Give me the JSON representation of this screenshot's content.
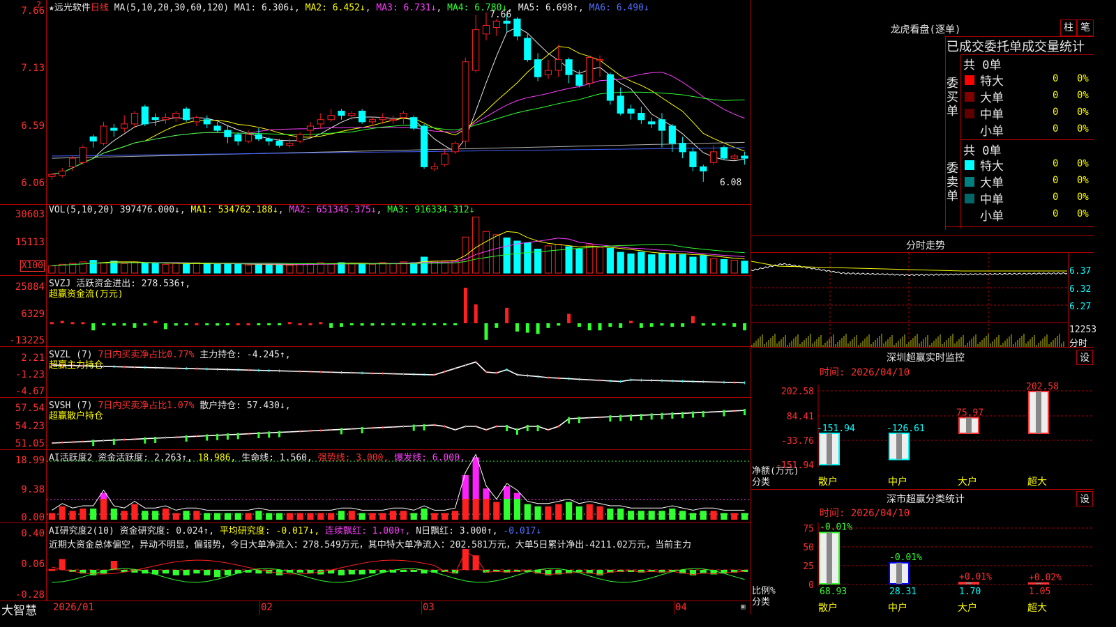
{
  "colors": {
    "up": "#ff2020",
    "down": "#00ffff",
    "grid": "#b00000"
  },
  "main_chart": {
    "header": {
      "star": "★",
      "name": "远光软件",
      "period": "日线",
      "ma_title": "MA(5,10,20,30,60,120)",
      "ma1": "MA1: 6.306↓",
      "ma2": "MA2: 6.452↓",
      "ma3": "MA3: 6.731↓",
      "ma4": "MA4: 6.780↓",
      "ma5": "MA5: 6.698↑",
      "ma6": "MA6: 6.490↓"
    },
    "y_ticks": [
      "7.66",
      "7.13",
      "6.59",
      "6.06"
    ],
    "high_label": "7.66",
    "low_label": "6.08"
  },
  "vol_panel": {
    "title": "VOL(5,10,20)",
    "vol": "397476.000↓",
    "ma1": "MA1: 534762.188↓",
    "ma2": "MA2: 651345.375↓",
    "ma3": "MA3: 916334.312↓",
    "y_ticks": [
      "30603",
      "15113"
    ],
    "unit": "X100"
  },
  "svzj_panel": {
    "title": "SVZJ  活跃资金进出: 278.536↑,",
    "subtitle": "超赢资金流(万元)",
    "y_ticks": [
      "25884",
      "6329",
      "-13225"
    ]
  },
  "svzl_panel": {
    "title": "SVZL (7) ",
    "title_red": "7日内买卖净占比0.77%",
    "title_w": " 主力持仓: -4.245↑,",
    "subtitle": "超赢主力持仓",
    "y_ticks": [
      "2.21",
      "-1.23",
      "-4.67"
    ]
  },
  "svsh_panel": {
    "title": "SVSH (7) ",
    "title_red": "7日内买卖净占比1.07%",
    "title_w": " 散户持仓: 57.430↓,",
    "subtitle": "超赢散户持仓",
    "y_ticks": [
      "57.54",
      "54.23",
      "51.05"
    ]
  },
  "ai_act_panel": {
    "t1": "AI活跃度2 资金活跃度: 2.263↑,",
    "t2": "18.986,",
    "t3": "生命线: 1.560,",
    "t4": "强势线: 3.000,",
    "t5": "爆发线: 6.000,",
    "y_ticks": [
      "18.99",
      "9.38",
      "0.00"
    ]
  },
  "ai_res_panel": {
    "t1": "AI研究度2(10) 资金研究度: 0.024↑,",
    "t2": "平均研究度: -0.017↓,",
    "t3": "连续飘红: 1.000↑,",
    "t4": "N日飘红: 3.000↑,",
    "t5": "-0.017↓",
    "summary": "近期大资金总体偏空，异动不明显，偏弱势，今日大单净流入：278.549万元，其中特大单净流入：202.581万元，大单5日累计净出-4211.02万元，当前主力",
    "y_ticks": [
      "0.40",
      "0.06",
      "-0.28"
    ]
  },
  "x_axis": {
    "labels": [
      "2026/01",
      "02",
      "03",
      "04"
    ],
    "brand": "大智慧"
  },
  "right": {
    "lhb_title": "龙虎看盘(逐单)",
    "btn_zhu": "柱",
    "btn_bi": "笔",
    "stats_title": "已成交委托单成交量统计",
    "buy": {
      "label": "委买单",
      "total": "共 0单",
      "rows": [
        {
          "name": "特大",
          "val": "0",
          "pct": "0%",
          "color": "#ff0000"
        },
        {
          "name": "大单",
          "val": "0",
          "pct": "0%",
          "color": "#800000"
        },
        {
          "name": "中单",
          "val": "0",
          "pct": "0%",
          "color": "#600000"
        },
        {
          "name": "小单",
          "val": "0",
          "pct": "0%",
          "color": "#000000"
        }
      ]
    },
    "sell": {
      "label": "委卖单",
      "total": "共 0单",
      "rows": [
        {
          "name": "特大",
          "val": "0",
          "pct": "0%",
          "color": "#00ffff"
        },
        {
          "name": "大单",
          "val": "0",
          "pct": "0%",
          "color": "#008080"
        },
        {
          "name": "中单",
          "val": "0",
          "pct": "0%",
          "color": "#006868"
        },
        {
          "name": "小单",
          "val": "0",
          "pct": "0%",
          "color": "#000000"
        }
      ]
    },
    "fenshi": {
      "title": "分时走势",
      "prices": [
        "6.37",
        "6.32",
        "6.27"
      ],
      "vol": "12253",
      "unit": "分时"
    },
    "monitor": {
      "title": "深圳超赢实时监控",
      "btn": "设",
      "time": "时间: 2026/04/10",
      "y_ticks": [
        "202.58",
        "84.41",
        "-33.76",
        "-151.94"
      ],
      "ylabel": "净额(万元)",
      "xlabel": "分类",
      "cats": [
        "散户",
        "中户",
        "大户",
        "超大"
      ],
      "values": [
        -151.94,
        -126.61,
        75.97,
        202.58
      ],
      "labels": [
        "-151.94",
        "-126.61",
        "75.97",
        "202.58"
      ]
    },
    "classify": {
      "title": "深市超赢分类统计",
      "btn": "设",
      "time": "时间: 2026/04/10",
      "y_ticks": [
        "75",
        "50",
        "25",
        "0"
      ],
      "ylabel": "比例%",
      "xlabel": "分类",
      "cats": [
        "散户",
        "中户",
        "大户",
        "超大"
      ],
      "values": [
        68.93,
        28.31,
        1.7,
        1.05
      ],
      "bottom_labels": [
        "68.93",
        "28.31",
        "1.70",
        "1.05"
      ],
      "top_labels": [
        "-0.01%",
        "-0.01%",
        "+0.01%",
        "+0.02%"
      ]
    }
  },
  "chart_data": {
    "type": "candlestick",
    "title": "远光软件 日线",
    "x": [
      "2026/01",
      "02",
      "03",
      "04"
    ],
    "ylim": [
      6.06,
      7.66
    ],
    "candles": [
      [
        6.13,
        6.15,
        6.1,
        6.16
      ],
      [
        6.14,
        6.18,
        6.12,
        6.21
      ],
      [
        6.22,
        6.3,
        6.18,
        6.32
      ],
      [
        6.26,
        6.4,
        6.24,
        6.42
      ],
      [
        6.5,
        6.46,
        6.4,
        6.52
      ],
      [
        6.44,
        6.6,
        6.42,
        6.64
      ],
      [
        6.58,
        6.56,
        6.5,
        6.62
      ],
      [
        6.58,
        6.62,
        6.54,
        6.7
      ],
      [
        6.62,
        6.72,
        6.58,
        6.74
      ],
      [
        6.78,
        6.62,
        6.6,
        6.8
      ],
      [
        6.68,
        6.66,
        6.6,
        6.72
      ],
      [
        6.66,
        6.68,
        6.62,
        6.72
      ],
      [
        6.68,
        6.72,
        6.64,
        6.74
      ],
      [
        6.76,
        6.66,
        6.64,
        6.78
      ],
      [
        6.64,
        6.68,
        6.6,
        6.7
      ],
      [
        6.66,
        6.62,
        6.58,
        6.7
      ],
      [
        6.6,
        6.56,
        6.54,
        6.64
      ],
      [
        6.56,
        6.5,
        6.44,
        6.6
      ],
      [
        6.52,
        6.46,
        6.42,
        6.54
      ],
      [
        6.46,
        6.52,
        6.44,
        6.56
      ],
      [
        6.52,
        6.48,
        6.46,
        6.58
      ],
      [
        6.48,
        6.46,
        6.42,
        6.5
      ],
      [
        6.46,
        6.42,
        6.4,
        6.48
      ],
      [
        6.42,
        6.44,
        6.4,
        6.48
      ],
      [
        6.46,
        6.52,
        6.44,
        6.54
      ],
      [
        6.56,
        6.6,
        6.5,
        6.64
      ],
      [
        6.62,
        6.66,
        6.58,
        6.72
      ],
      [
        6.66,
        6.7,
        6.64,
        6.76
      ],
      [
        6.74,
        6.7,
        6.66,
        6.76
      ],
      [
        6.7,
        6.72,
        6.66,
        6.74
      ],
      [
        6.74,
        6.64,
        6.62,
        6.76
      ],
      [
        6.64,
        6.66,
        6.6,
        6.68
      ],
      [
        6.66,
        6.68,
        6.62,
        6.72
      ],
      [
        6.66,
        6.66,
        6.62,
        6.7
      ],
      [
        6.68,
        6.72,
        6.62,
        6.74
      ],
      [
        6.68,
        6.58,
        6.56,
        6.7
      ],
      [
        6.6,
        6.22,
        6.2,
        6.62
      ],
      [
        6.2,
        6.22,
        6.18,
        6.26
      ],
      [
        6.24,
        6.34,
        6.22,
        6.38
      ],
      [
        6.36,
        6.44,
        6.34,
        6.46
      ],
      [
        6.46,
        7.2,
        6.4,
        7.24
      ],
      [
        7.12,
        7.5,
        7.1,
        7.64
      ],
      [
        7.46,
        7.54,
        7.4,
        7.66
      ],
      [
        7.52,
        7.58,
        7.44,
        7.6
      ],
      [
        7.58,
        7.56,
        7.48,
        7.64
      ],
      [
        7.6,
        7.44,
        7.4,
        7.62
      ],
      [
        7.42,
        7.22,
        7.2,
        7.46
      ],
      [
        7.22,
        7.06,
        7.02,
        7.28
      ],
      [
        7.08,
        7.12,
        7.04,
        7.22
      ],
      [
        7.12,
        7.22,
        7.06,
        7.36
      ],
      [
        7.22,
        7.08,
        7.0,
        7.24
      ],
      [
        7.08,
        6.98,
        6.96,
        7.12
      ],
      [
        7.0,
        7.24,
        6.96,
        7.26
      ],
      [
        7.22,
        7.22,
        7.06,
        7.26
      ],
      [
        7.08,
        6.84,
        6.8,
        7.1
      ],
      [
        6.88,
        6.72,
        6.7,
        6.96
      ],
      [
        6.76,
        6.72,
        6.66,
        6.8
      ],
      [
        6.72,
        6.66,
        6.62,
        6.78
      ],
      [
        6.64,
        6.62,
        6.58,
        6.68
      ],
      [
        6.66,
        6.56,
        6.4,
        6.72
      ],
      [
        6.6,
        6.44,
        6.36,
        6.62
      ],
      [
        6.44,
        6.36,
        6.3,
        6.5
      ],
      [
        6.36,
        6.22,
        6.18,
        6.4
      ],
      [
        6.22,
        6.18,
        6.08,
        6.24
      ],
      [
        6.26,
        6.36,
        6.24,
        6.42
      ],
      [
        6.4,
        6.3,
        6.28,
        6.42
      ],
      [
        6.3,
        6.32,
        6.28,
        6.34
      ],
      [
        6.32,
        6.3,
        6.24,
        6.36
      ]
    ]
  }
}
